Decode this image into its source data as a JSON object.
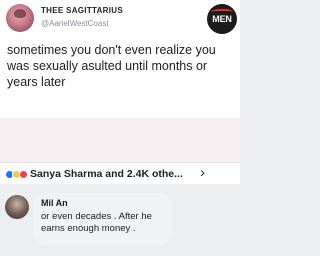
{
  "tweet": {
    "author_name": "THEE SAGITTARIUS",
    "author_handle": "@AarielWestCoast",
    "text": "sometimes you don't even realize you was sexually asulted until months or years later",
    "logo_text": "MEN"
  },
  "reactions": {
    "icons": [
      "like-icon",
      "haha-icon",
      "love-icon"
    ],
    "summary": "Sanya Sharma and 2.4K othe...",
    "chevron": "›"
  },
  "comment": {
    "author": "Mil An",
    "text": "or even decades . After he earns enough money ."
  },
  "colors": {
    "like": "#1877f2",
    "haha": "#f7c84b",
    "love": "#f33e58",
    "bubble": "#f0f2f5",
    "logo_accent": "#e8322b"
  }
}
